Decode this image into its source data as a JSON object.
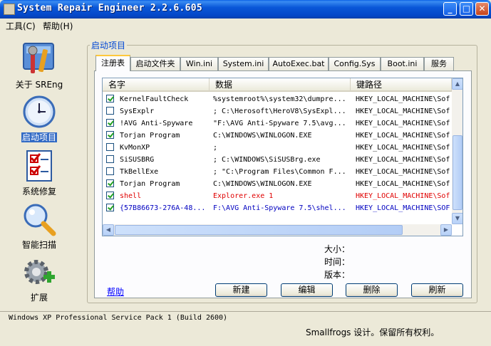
{
  "window": {
    "title": "System Repair Engineer 2.2.6.605"
  },
  "menu": [
    {
      "label": "工具(C)"
    },
    {
      "label": "帮助(H)"
    }
  ],
  "nav": [
    {
      "label": "关于 SREng",
      "icon": "tools-icon"
    },
    {
      "label": "启动项目",
      "icon": "clock-icon",
      "selected": true
    },
    {
      "label": "系统修复",
      "icon": "checklist-icon"
    },
    {
      "label": "智能扫描",
      "icon": "magnifier-icon"
    },
    {
      "label": "扩展",
      "icon": "gear-plus-icon"
    }
  ],
  "group_title": "启动项目",
  "tabs": [
    {
      "label": "注册表",
      "active": true
    },
    {
      "label": "启动文件夹"
    },
    {
      "label": "Win.ini"
    },
    {
      "label": "System.ini"
    },
    {
      "label": "AutoExec.bat"
    },
    {
      "label": "Config.Sys"
    },
    {
      "label": "Boot.ini"
    },
    {
      "label": "服务"
    }
  ],
  "columns": [
    "名字",
    "数据",
    "键路径"
  ],
  "rows": [
    {
      "checked": true,
      "name": "KernelFaultCheck",
      "data": "%systemroot%\\system32\\dumpre...",
      "path": "HKEY_LOCAL_MACHINE\\Sof"
    },
    {
      "checked": false,
      "name": "SysExplr",
      "data": "; C:\\Herosoft\\HeroV8\\SysExpl...",
      "path": "HKEY_LOCAL_MACHINE\\Sof"
    },
    {
      "checked": true,
      "name": "!AVG Anti-Spyware",
      "data": "\"F:\\AVG Anti-Spyware 7.5\\avg...",
      "path": "HKEY_LOCAL_MACHINE\\Sof"
    },
    {
      "checked": true,
      "name": "Torjan Program",
      "data": "C:\\WINDOWS\\WINLOGON.EXE",
      "path": "HKEY_LOCAL_MACHINE\\Sof"
    },
    {
      "checked": false,
      "name": "KvMonXP",
      "data": ";",
      "path": "HKEY_LOCAL_MACHINE\\Sof"
    },
    {
      "checked": false,
      "name": "SiSUSBRG",
      "data": "; C:\\WINDOWS\\SiSUSBrg.exe",
      "path": "HKEY_LOCAL_MACHINE\\Sof"
    },
    {
      "checked": false,
      "name": "TkBellExe",
      "data": "; \"C:\\Program Files\\Common F...",
      "path": "HKEY_LOCAL_MACHINE\\Sof"
    },
    {
      "checked": true,
      "name": "Torjan Program",
      "data": "C:\\WINDOWS\\WINLOGON.EXE",
      "path": "HKEY_LOCAL_MACHINE\\Sof"
    },
    {
      "checked": true,
      "name": "shell",
      "data": "Explorer.exe 1",
      "path": "HKEY_LOCAL_MACHINE\\Sof",
      "color": "red"
    },
    {
      "checked": true,
      "name": "{57B86673-276A-48...",
      "data": "F:\\AVG Anti-Spyware 7.5\\shel...",
      "path": "HKEY_LOCAL_MACHINE\\SOF",
      "color": "blue"
    }
  ],
  "info": {
    "size_label": "大小：",
    "time_label": "时间：",
    "version_label": "版本："
  },
  "help_link": "帮助",
  "buttons": {
    "new": "新建",
    "edit": "编辑",
    "delete": "删除",
    "refresh": "刷新"
  },
  "status": {
    "os": "Windows XP Professional Service Pack 1 (Build 2600)",
    "copyright": "Smallfrogs 设计。保留所有权利。"
  },
  "colors": {
    "selection": "#316ac5",
    "red_text": "#e00000",
    "blue_text": "#0000c0",
    "link": "#0000ff"
  }
}
